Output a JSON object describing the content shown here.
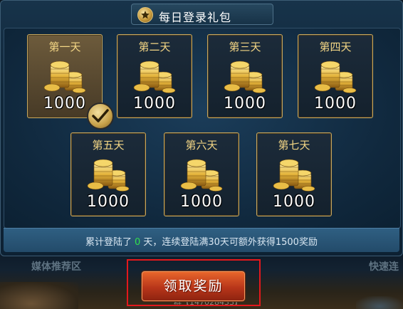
{
  "dialog": {
    "title": "每日登录礼包",
    "title_icon": "star-icon"
  },
  "rewards": [
    {
      "day": "第一天",
      "amount": "1000",
      "claimed": true
    },
    {
      "day": "第二天",
      "amount": "1000",
      "claimed": false
    },
    {
      "day": "第三天",
      "amount": "1000",
      "claimed": false
    },
    {
      "day": "第四天",
      "amount": "1000",
      "claimed": false
    },
    {
      "day": "第五天",
      "amount": "1000",
      "claimed": false
    },
    {
      "day": "第六天",
      "amount": "1000",
      "claimed": false
    },
    {
      "day": "第七天",
      "amount": "1000",
      "claimed": false
    }
  ],
  "info": {
    "prefix": "累计登陆了",
    "count": "0",
    "suffix": "天，连续登陆满30天可额外获得1500奖励"
  },
  "claim_button": {
    "label": "领取奖励"
  },
  "background": {
    "left_label": "媒体推荐区",
    "right_label": "快速连",
    "footer_text": "群【147028433】"
  },
  "colors": {
    "accent_gold": "#c7a861",
    "info_count": "#32e14b",
    "button": "#d04a22",
    "highlight_border": "#e3181c"
  }
}
